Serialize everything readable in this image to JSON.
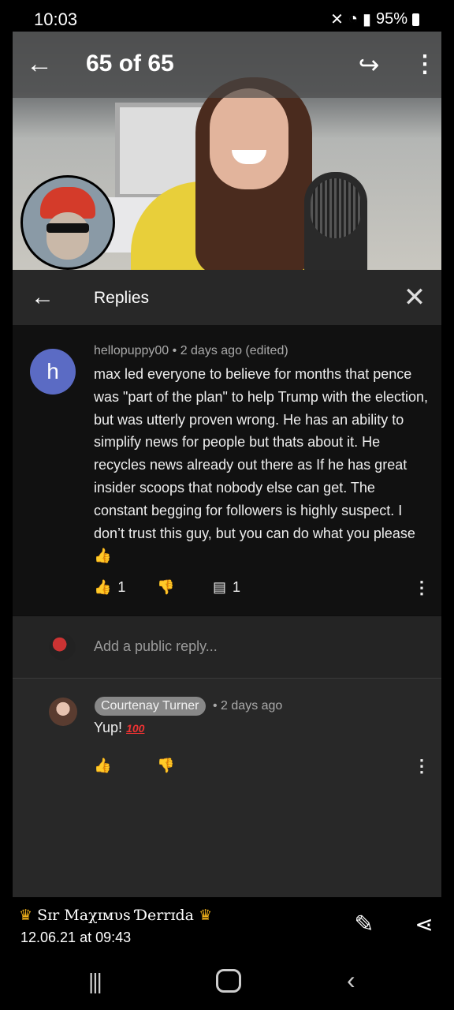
{
  "status": {
    "time": "10:03",
    "battery": "95%"
  },
  "gallery": {
    "counter": "65 of 65"
  },
  "replies_panel": {
    "title": "Replies",
    "comment": {
      "avatar_letter": "h",
      "meta": "hellopuppy00 • 2 days ago (edited)",
      "text": "max led everyone to believe for months that pence was \"part of the plan\" to help Trump with the election, but was utterly proven wrong.  He has an ability to simplify news for people but thats about it. He recycles news already out there as If he has great insider scoops that nobody else can get. The constant begging for followers is highly suspect. I don’t trust this guy, but you can do what you please",
      "likes": "1",
      "replies": "1"
    },
    "add_reply_placeholder": "Add a public reply...",
    "reply": {
      "author": "Courtenay Turner",
      "time": "• 2 days ago",
      "text": "Yup!",
      "emoji": "100"
    }
  },
  "bottom": {
    "crown": "♛",
    "author": "Sɪr Maχɪмυs Ɗerrɪda",
    "date": "12.06.21 at 09:43"
  },
  "icons": {
    "back": "←",
    "share": "↪",
    "more": "⋮",
    "close": "✕",
    "like": "👍",
    "dislike": "👎",
    "reply": "▤",
    "edit": "✎",
    "share_nodes": "⋖"
  }
}
